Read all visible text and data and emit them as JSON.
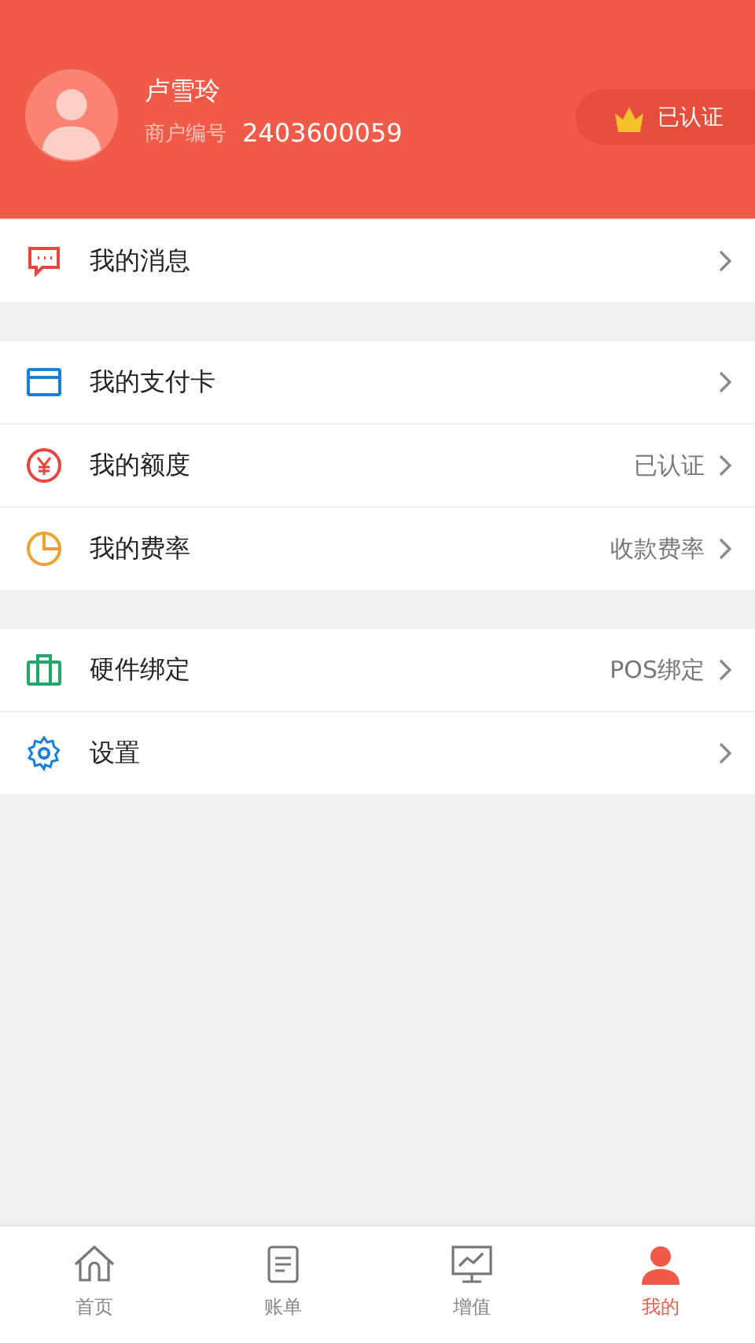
{
  "profile": {
    "name": "卢雪玲",
    "id_label": "商户编号",
    "id_value": "2403600059",
    "badge": "已认证"
  },
  "groups": [
    {
      "items": [
        {
          "kind": "message",
          "label": "我的消息"
        }
      ]
    },
    {
      "items": [
        {
          "kind": "card",
          "label": "我的支付卡"
        },
        {
          "kind": "yen",
          "label": "我的额度",
          "value": "已认证"
        },
        {
          "kind": "pie",
          "label": "我的费率",
          "value": "收款费率"
        }
      ]
    },
    {
      "items": [
        {
          "kind": "briefcase",
          "label": "硬件绑定",
          "value": "POS绑定"
        },
        {
          "kind": "gear",
          "label": "设置"
        }
      ]
    }
  ],
  "tabs": [
    {
      "kind": "home",
      "label": "首页",
      "selected": false
    },
    {
      "kind": "bill",
      "label": "账单",
      "selected": false
    },
    {
      "kind": "chart",
      "label": "增值",
      "selected": false
    },
    {
      "kind": "person",
      "label": "我的",
      "selected": true
    }
  ]
}
